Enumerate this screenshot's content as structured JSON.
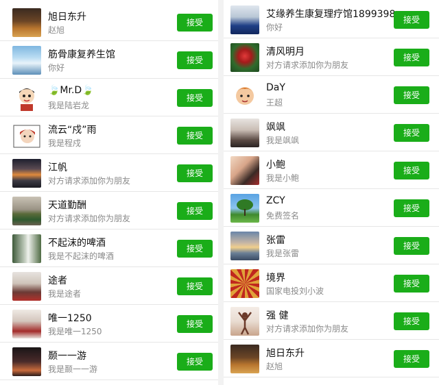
{
  "accept_label": "接受",
  "left_requests": [
    {
      "name": "旭日东升",
      "sub": "赵旭",
      "avatar_icon": "tea-cup-photo-avatar"
    },
    {
      "name": "筋骨康复养生馆",
      "sub": "你好",
      "avatar_icon": "glacier-photo-avatar"
    },
    {
      "name": "🍃Mr.D🍃",
      "sub": "我是陆岩龙",
      "avatar_icon": "cartoon-boy-avatar"
    },
    {
      "name": "流云“戍”雨",
      "sub": "我是程戍",
      "avatar_icon": "cartoon-girl-avatar"
    },
    {
      "name": "江帆",
      "sub": "对方请求添加你为朋友",
      "avatar_icon": "sunset-lake-avatar"
    },
    {
      "name": "天道勤酬",
      "sub": "对方请求添加你为朋友",
      "avatar_icon": "train-photo-avatar"
    },
    {
      "name": "不起沫的啤酒",
      "sub": "我是不起沫的啤酒",
      "avatar_icon": "waterfall-person-avatar"
    },
    {
      "name": "途者",
      "sub": "我是途者",
      "avatar_icon": "couple-photo-avatar"
    },
    {
      "name": "唯一1250",
      "sub": "我是唯一1250",
      "avatar_icon": "woman-costume-avatar"
    },
    {
      "name": "颞一一游",
      "sub": "我是颞一一游",
      "avatar_icon": "dark-photo-avatar"
    }
  ],
  "right_requests": [
    {
      "name": "艾缘养生康复理疗馆1899398...",
      "sub": "你好",
      "avatar_icon": "woman-portrait-avatar"
    },
    {
      "name": "清风明月",
      "sub": "对方请求添加你为朋友",
      "avatar_icon": "red-rose-avatar"
    },
    {
      "name": "DaY",
      "sub": "王超",
      "avatar_icon": "cartoon-face-avatar"
    },
    {
      "name": "飒飒",
      "sub": "我是飒飒",
      "avatar_icon": "girl-selfie-avatar"
    },
    {
      "name": "小鲍",
      "sub": "我是小鲍",
      "avatar_icon": "couple-selfie-avatar"
    },
    {
      "name": "ZCY",
      "sub": "免费签名",
      "avatar_icon": "tree-sky-avatar"
    },
    {
      "name": "张雷",
      "sub": "我是张雷",
      "avatar_icon": "sunset-sea-avatar"
    },
    {
      "name": "境界",
      "sub": "国家电投刘小波",
      "avatar_icon": "red-umbrella-avatar"
    },
    {
      "name": "强 健",
      "sub": "对方请求添加你为朋友",
      "avatar_icon": "dancer-avatar"
    },
    {
      "name": "旭日东升",
      "sub": "赵旭",
      "avatar_icon": "tea-cup-photo-avatar"
    }
  ]
}
